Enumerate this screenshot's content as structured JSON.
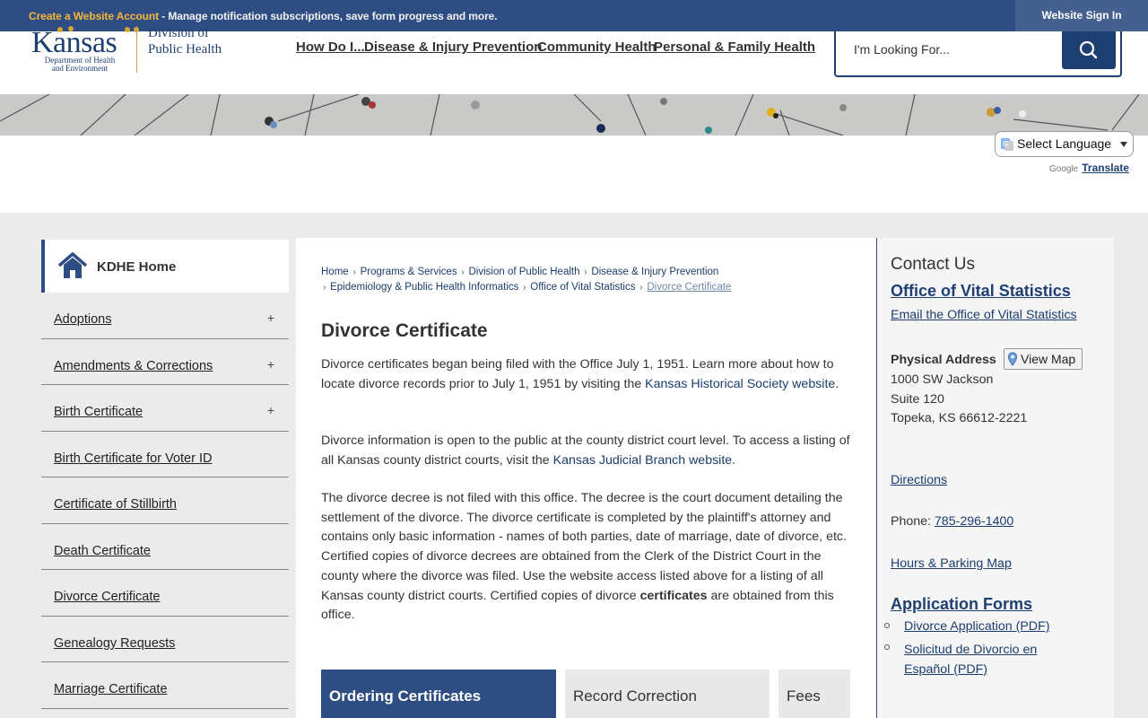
{
  "topbar": {
    "create_link": "Create a Website Account",
    "message": " - Manage notification subscriptions, save form progress and more.",
    "signin_label": "Website Sign In"
  },
  "logo": {
    "name": "Kansas",
    "dept_line1": "Department of Health",
    "dept_line2": "and Environment",
    "division_line1": "Division of",
    "division_line2": "Public Health"
  },
  "nav": {
    "items": [
      "How Do I...",
      "Disease & Injury Prevention",
      "Community Health",
      "Personal & Family Health"
    ]
  },
  "search": {
    "placeholder": "I'm Looking For...",
    "icon": "search-icon"
  },
  "translate": {
    "select_label": "Select Language",
    "powered_by": "Google",
    "translate_label": "Translate"
  },
  "sidebar": {
    "home_label": "KDHE Home",
    "items": [
      {
        "label": "Adoptions",
        "expand": "+"
      },
      {
        "label": "Amendments & Corrections",
        "expand": "+"
      },
      {
        "label": "Birth Certificate",
        "expand": "+"
      },
      {
        "label": "Birth Certificate for Voter ID",
        "expand": ""
      },
      {
        "label": "Certificate of Stillbirth",
        "expand": ""
      },
      {
        "label": "Death Certificate",
        "expand": ""
      },
      {
        "label": "Divorce Certificate",
        "expand": ""
      },
      {
        "label": "Genealogy Requests",
        "expand": ""
      },
      {
        "label": "Marriage Certificate",
        "expand": ""
      }
    ]
  },
  "breadcrumb": {
    "items": [
      "Home",
      "Programs & Services",
      "Division of Public Health",
      "Disease & Injury Prevention"
    ],
    "items2": [
      "Epidemiology & Public Health Informatics",
      "Office of Vital Statistics"
    ],
    "current": "Divorce Certificate"
  },
  "main": {
    "title": "Divorce Certificate",
    "p1_text": "Divorce certificates began being filed with the Office July 1, 1951. Learn more about how to locate divorce records prior to July 1, 1951 by visiting the ",
    "p1_link": "Kansas Historical Society website",
    "p1_end": ".",
    "p2_text": "Divorce information is open to the public at the county district court level. To access a listing of all Kansas county district courts, visit the ",
    "p2_link": "Kansas Judicial Branch website",
    "p2_end": ".",
    "p3_text": "The divorce decree is not filed with this office. The decree is the court document detailing the settlement of the divorce. The divorce certificate is completed by the plaintiff's attorney and contains only basic information - names of both parties, date of marriage, date of divorce, etc. Certified copies of divorce decrees are obtained from the Clerk of the District Court in the county where the divorce was filed. Use the website access listed above for a listing of all Kansas county district courts. Certified copies of divorce ",
    "p3_bold": "certificates",
    "p3_end": " are obtained from this office.",
    "tabs": [
      "Ordering Certificates",
      "Record Correction",
      "Fees"
    ]
  },
  "contact": {
    "heading": "Contact Us",
    "office": "Office of Vital Statistics",
    "email": "Email the Office of Vital Statistics",
    "address_label": "Physical Address",
    "view_map": "View Map",
    "addr1": "1000 SW Jackson",
    "addr2": "Suite 120",
    "addr3": "Topeka, KS 66612-2221",
    "directions": "Directions",
    "phone_label": "Phone: ",
    "phone": "785-296-1400",
    "hours": "Hours & Parking Map",
    "forms_heading": "Application Forms",
    "form1": "Divorce Application (PDF)",
    "form2a": "Solicitud de Divorcio en",
    "form2b": "Español (PDF)"
  },
  "colors": {
    "brand": "#2e4d82",
    "accent": "#f6b83a",
    "link": "#1a3d6d"
  }
}
